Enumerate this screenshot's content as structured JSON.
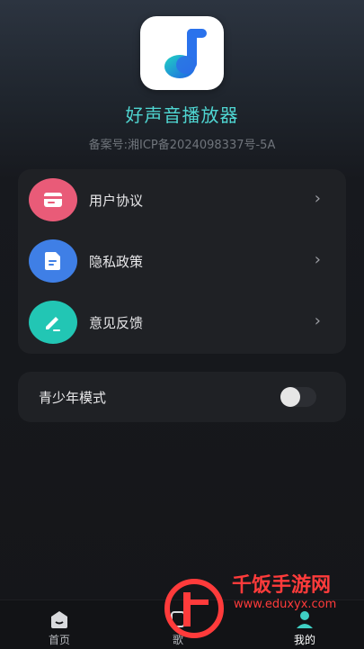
{
  "app": {
    "name": "好声音播放器",
    "icp": "备案号:湘ICP备2024098337号-5A"
  },
  "menu": [
    {
      "label": "用户协议",
      "icon": "card-icon",
      "color": "#e95b78"
    },
    {
      "label": "隐私政策",
      "icon": "document-icon",
      "color": "#3f7fe6"
    },
    {
      "label": "意见反馈",
      "icon": "pencil-icon",
      "color": "#22c6b4"
    }
  ],
  "teen_mode": {
    "label": "青少年模式",
    "enabled": false
  },
  "tabs": [
    {
      "label": "首页",
      "active": false
    },
    {
      "label": "歌",
      "active": false
    },
    {
      "label": "我的",
      "active": true
    }
  ],
  "watermark": {
    "text": "千饭手游网",
    "url": "www.eduxyx.com"
  },
  "colors": {
    "accent": "#4fd6d2",
    "background": "#151619",
    "card": "#1f2125"
  }
}
